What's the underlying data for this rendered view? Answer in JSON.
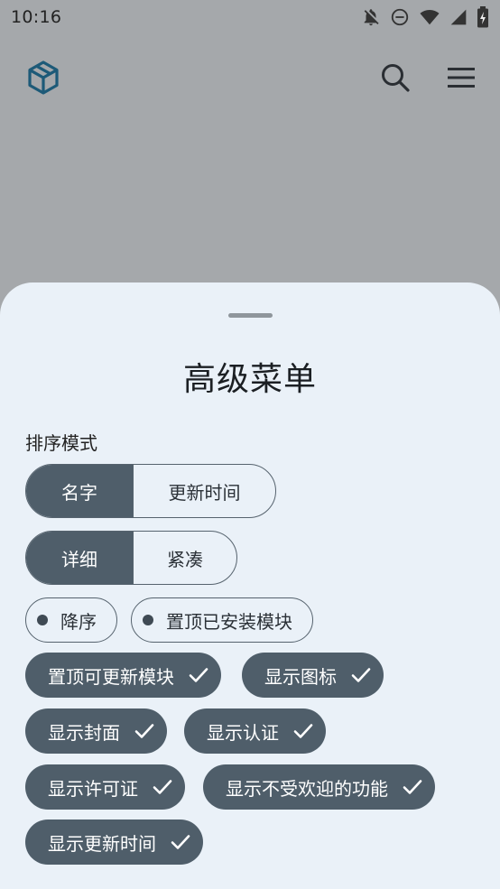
{
  "status_bar": {
    "time": "10:16",
    "icons": [
      "bell-off-icon",
      "do-not-disturb-icon",
      "wifi-icon",
      "cellular-signal-icon",
      "battery-icon"
    ]
  },
  "app_bar": {
    "logo_icon": "cube-logo-icon",
    "actions": [
      "search-icon",
      "menu-icon"
    ]
  },
  "sheet": {
    "title": "高级菜单",
    "sort_label": "排序模式",
    "sort_segments": [
      {
        "label": "名字",
        "selected": true
      },
      {
        "label": "更新时间",
        "selected": false
      }
    ],
    "view_segments": [
      {
        "label": "详细",
        "selected": true
      },
      {
        "label": "紧凑",
        "selected": false
      }
    ],
    "toggle_chips": [
      {
        "label": "降序"
      },
      {
        "label": "置顶已安装模块"
      }
    ],
    "filter_chips": [
      {
        "label": "置顶可更新模块",
        "checked": true
      },
      {
        "label": "显示图标",
        "checked": true
      },
      {
        "label": "显示封面",
        "checked": true
      },
      {
        "label": "显示认证",
        "checked": true
      },
      {
        "label": "显示许可证",
        "checked": true
      },
      {
        "label": "显示不受欢迎的功能",
        "checked": true
      },
      {
        "label": "显示更新时间",
        "checked": true
      }
    ]
  },
  "colors": {
    "scrim": "#a5a8ab",
    "sheet_bg": "#eaf1f8",
    "accent": "#4f5e6a",
    "logo": "#1d5a78"
  }
}
